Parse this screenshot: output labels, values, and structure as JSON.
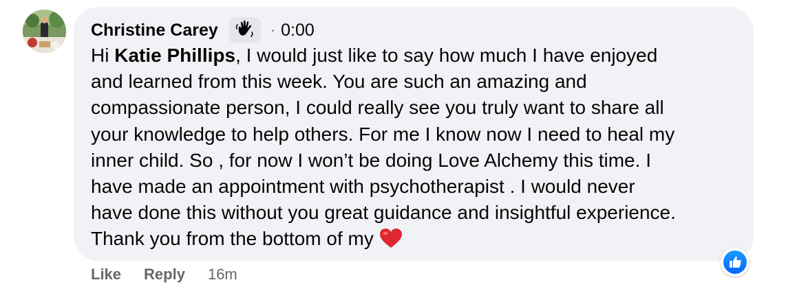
{
  "comment": {
    "author": "Christine Carey",
    "separator": "·",
    "audio_time": "0:00",
    "lines": [
      {
        "before": "Hi ",
        "mention": "Katie Phillips",
        "after": ", I would just like to say how much I have enjoyed"
      },
      {
        "text": "and learned from this week. You are such an amazing and"
      },
      {
        "text": "compassionate person, I could really see you truly want to share all"
      },
      {
        "text": "your knowledge to help others. For me I know now I need to heal my"
      },
      {
        "text": "inner child. So , for now I won’t be doing Love Alchemy this time. I"
      },
      {
        "text": "have made an appointment with psychotherapist . I would never"
      },
      {
        "text": "have done this without you great guidance and insightful experience."
      },
      {
        "text": "Thank you from the bottom of my"
      }
    ],
    "end_emoji": "heart-icon"
  },
  "actions": {
    "like": "Like",
    "reply": "Reply",
    "age": "16m"
  },
  "reaction": {
    "icon": "thumbs-up-icon",
    "color": "#0866ff"
  },
  "colors": {
    "bubble": "#f0f2f5",
    "text": "#050505",
    "muted": "#65676b"
  }
}
